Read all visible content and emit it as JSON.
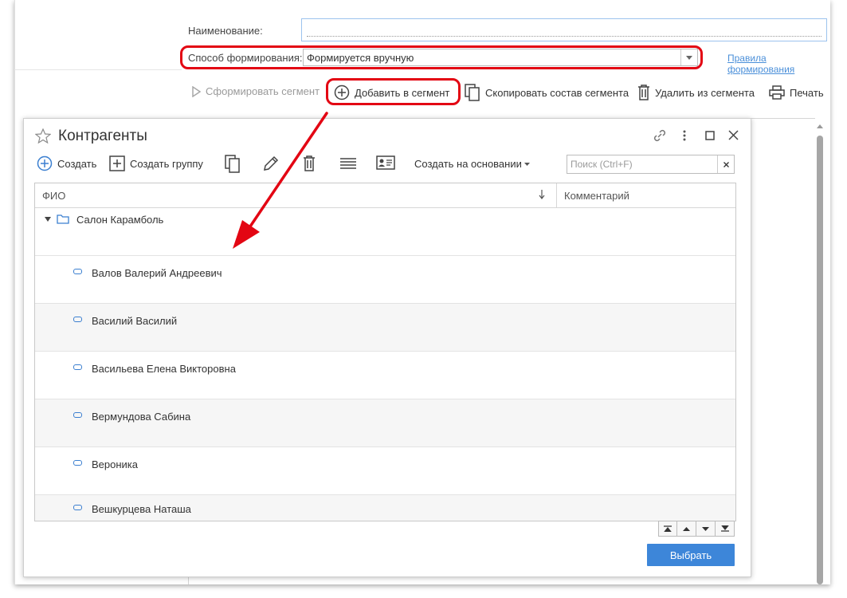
{
  "form": {
    "name_label": "Наименование:",
    "name_value": "",
    "method_label": "Способ формирования:",
    "method_value": "Формируется вручную",
    "rules_link": "Правила формирования"
  },
  "toolbar": {
    "form_segment": "Сформировать сегмент",
    "add_to_segment": "Добавить в сегмент",
    "copy_segment": "Скопировать состав сегмента",
    "remove_from_segment": "Удалить из сегмента",
    "print": "Печать"
  },
  "dialog": {
    "title": "Контрагенты",
    "create": "Создать",
    "create_group": "Создать группу",
    "create_based_on": "Создать на основании",
    "search_placeholder": "Поиск (Ctrl+F)",
    "columns": {
      "name": "ФИО",
      "comment": "Комментарий"
    },
    "group": "Салон Карамболь",
    "rows": [
      "Валов Валерий Андреевич",
      "Василий Василий",
      "Васильева Елена Викторовна",
      "Вермундова Сабина",
      "Вероника",
      "Вешкурцева Наташа"
    ],
    "select_button": "Выбрать"
  },
  "colors": {
    "accent": "#3d86d9",
    "highlight": "#e30613",
    "icon": "#3b7fd0"
  }
}
